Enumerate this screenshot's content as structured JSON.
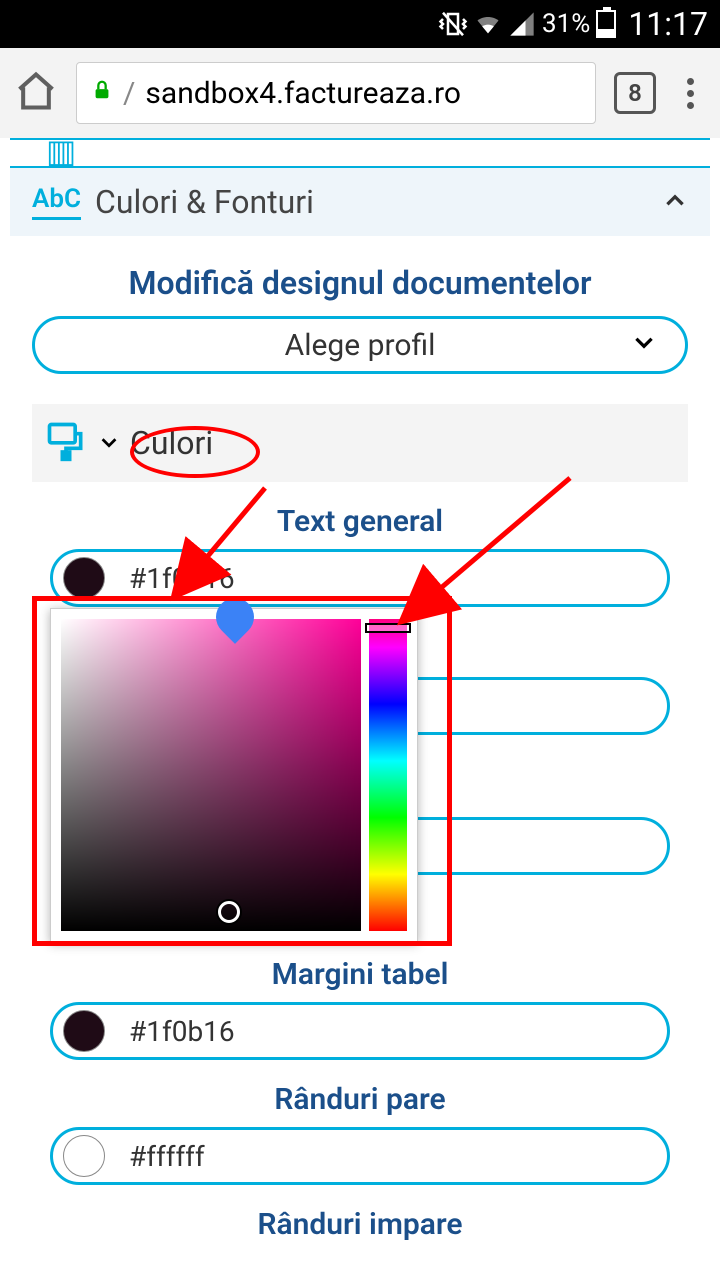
{
  "status": {
    "battery_pct": "31%",
    "time": "11:17"
  },
  "browser": {
    "url_host": "sandbox4.factureaza.ro",
    "tabs_count": "8"
  },
  "section": {
    "abc": "AbC",
    "title": "Culori & Fonturi"
  },
  "heading": "Modifică designul documentelor",
  "profile_select": "Alege profil",
  "subsection": "Culori",
  "fields": {
    "text_general": {
      "label": "Text general",
      "value": "#1f0b16",
      "swatch": "#1f0b16"
    },
    "margini_tabel": {
      "label": "Margini tabel",
      "value": "#1f0b16",
      "swatch": "#1f0b16"
    },
    "randuri_pare": {
      "label": "Rânduri pare",
      "value": "#ffffff",
      "swatch": "#ffffff"
    },
    "randuri_impare": {
      "label": "Rânduri impare"
    }
  },
  "picker": {
    "hue_color": "#ff0099"
  }
}
